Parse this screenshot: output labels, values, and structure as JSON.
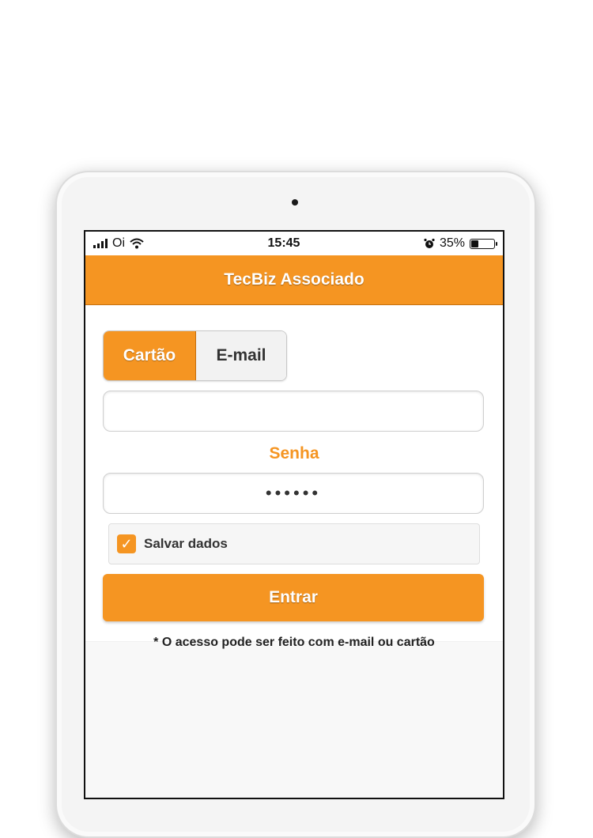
{
  "status_bar": {
    "carrier": "Oi",
    "time": "15:45",
    "battery": "35%",
    "battery_level": 0.35
  },
  "app_bar": {
    "title": "TecBiz Associado"
  },
  "login": {
    "tabs": [
      {
        "label": "Cartão",
        "active": true
      },
      {
        "label": "E-mail",
        "active": false
      }
    ],
    "card_input": {
      "value": "",
      "placeholder": ""
    },
    "password_label": "Senha",
    "password_value": "••••••",
    "save_data": {
      "label": "Salvar dados",
      "checked": true
    },
    "submit_label": "Entrar",
    "note": "* O acesso pode ser feito com e-mail ou cartão"
  },
  "colors": {
    "accent": "#f59522"
  }
}
